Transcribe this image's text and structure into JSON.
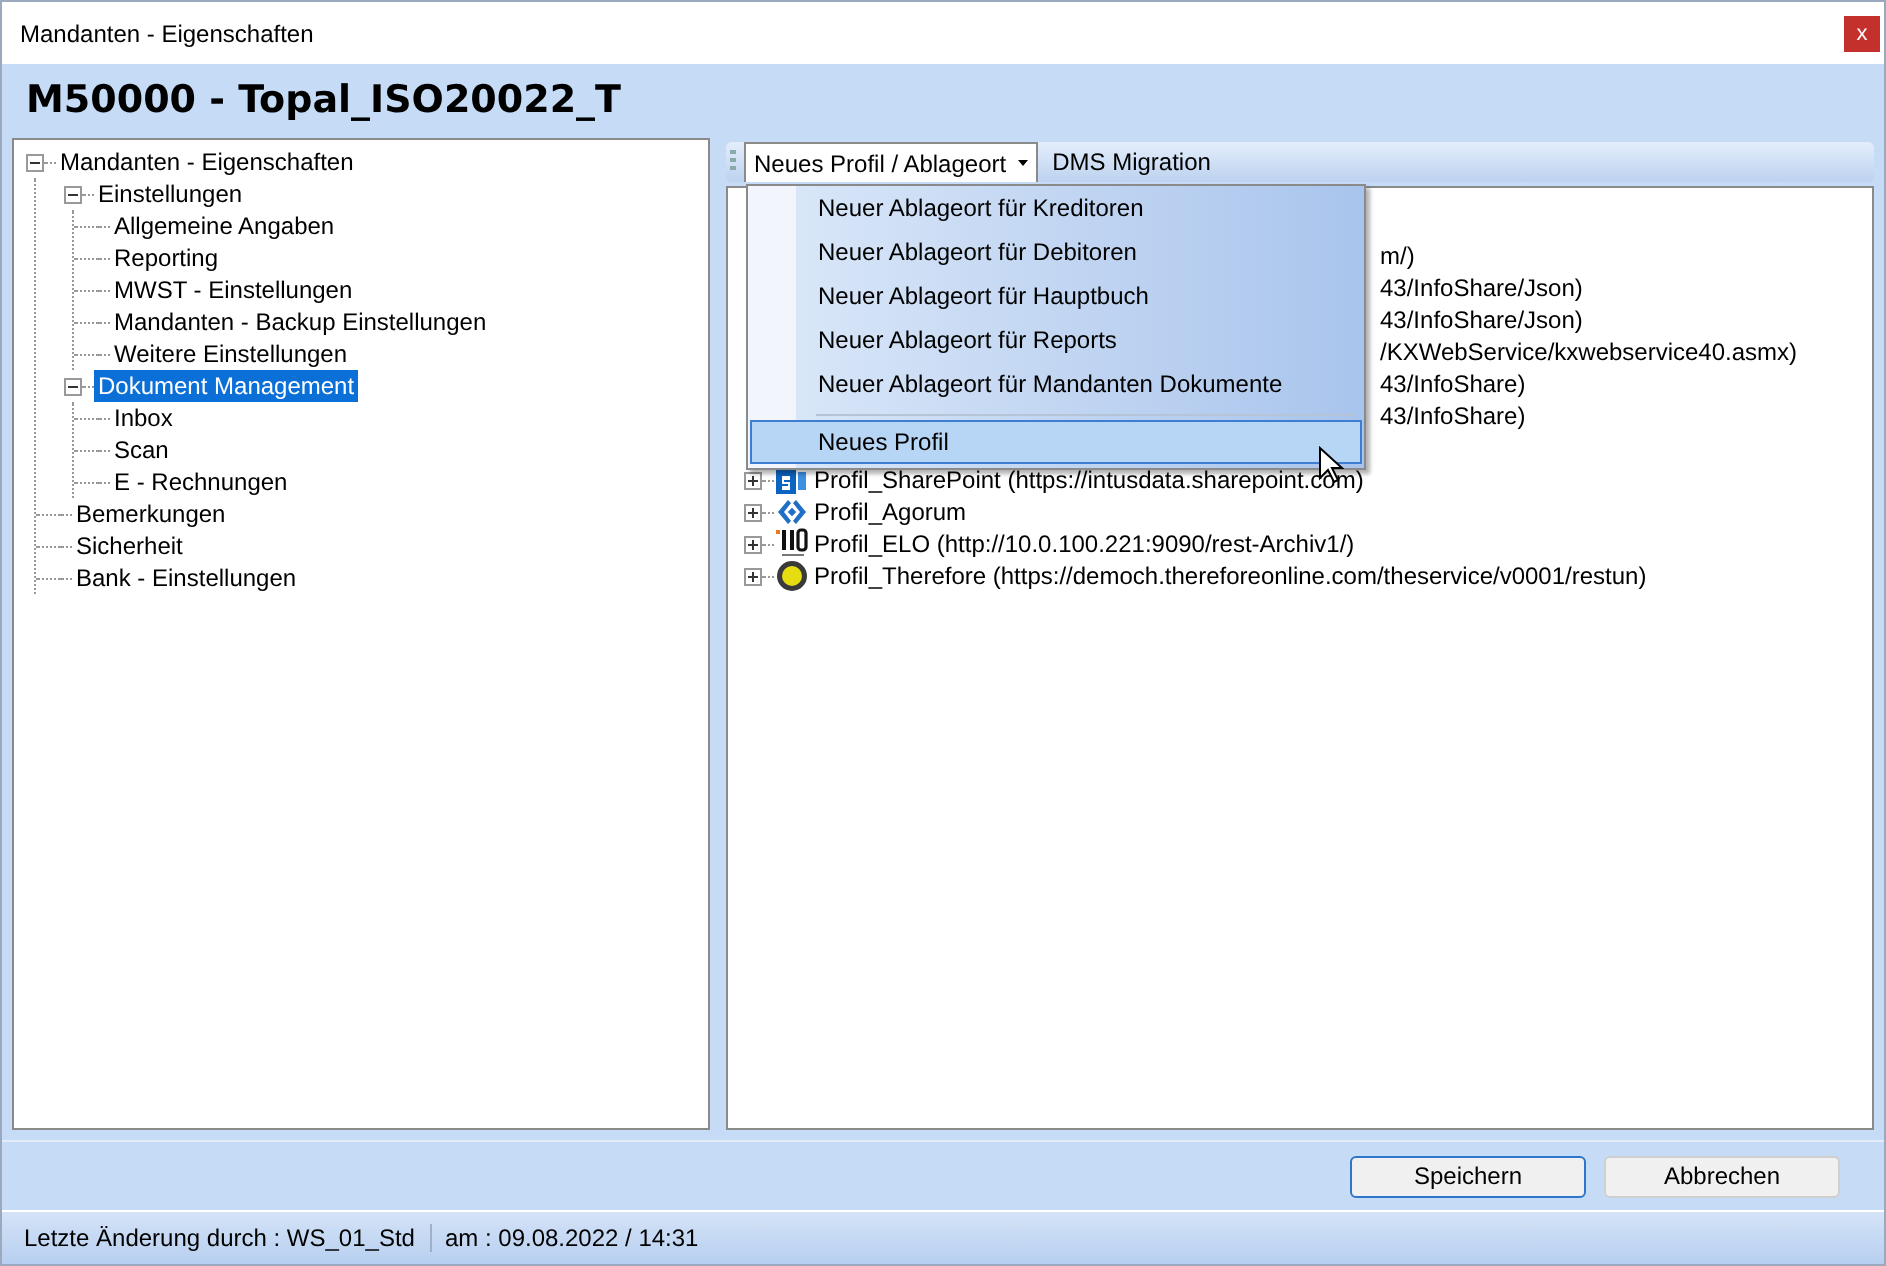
{
  "window": {
    "title": "Mandanten - Eigenschaften",
    "close": "x"
  },
  "header": {
    "title": "M50000 - Topal_ISO20022_T"
  },
  "nav_tree": [
    {
      "label": "Mandanten - Eigenschaften",
      "selected": false,
      "expanded": true,
      "children": [
        {
          "label": "Einstellungen",
          "selected": false,
          "expanded": true,
          "children": [
            {
              "label": "Allgemeine Angaben",
              "selected": false
            },
            {
              "label": "Reporting",
              "selected": false
            },
            {
              "label": "MWST - Einstellungen",
              "selected": false
            },
            {
              "label": "Mandanten - Backup Einstellungen",
              "selected": false
            },
            {
              "label": "Weitere Einstellungen",
              "selected": false
            }
          ]
        },
        {
          "label": "Dokument Management",
          "selected": true,
          "expanded": true,
          "children": [
            {
              "label": "Inbox",
              "selected": false
            },
            {
              "label": "Scan",
              "selected": false
            },
            {
              "label": "E - Rechnungen",
              "selected": false
            }
          ]
        },
        {
          "label": "Bemerkungen",
          "selected": false
        },
        {
          "label": "Sicherheit",
          "selected": false
        },
        {
          "label": "Bank - Einstellungen",
          "selected": false
        }
      ]
    }
  ],
  "toolbar": {
    "items": [
      {
        "label": "Neues Profil / Ablageort",
        "kind": "dropdown",
        "selected": true
      },
      {
        "label": "DMS Migration",
        "kind": "button",
        "selected": false
      }
    ]
  },
  "dropdown_menu": {
    "items": [
      {
        "kind": "item",
        "label": "Neuer Ablageort für Kreditoren",
        "selected": false
      },
      {
        "kind": "item",
        "label": "Neuer Ablageort für Debitoren",
        "selected": false
      },
      {
        "kind": "item",
        "label": "Neuer Ablageort für Hauptbuch",
        "selected": false
      },
      {
        "kind": "item",
        "label": "Neuer Ablageort für Reports",
        "selected": false
      },
      {
        "kind": "item",
        "label": "Neuer Ablageort für Mandanten Dokumente",
        "selected": false
      },
      {
        "kind": "separator"
      },
      {
        "kind": "item",
        "label": "Neues Profil",
        "selected": true
      }
    ]
  },
  "profiles_tree": {
    "rows": [
      {
        "kind": "hidden"
      },
      {
        "kind": "covered",
        "text": "m/)"
      },
      {
        "kind": "covered",
        "text": "43/InfoShare/Json)"
      },
      {
        "kind": "covered",
        "text": "43/InfoShare/Json)"
      },
      {
        "kind": "covered",
        "text": "/KXWebService/kxwebservice40.asmx)"
      },
      {
        "kind": "covered",
        "text": "43/InfoShare)"
      },
      {
        "kind": "covered",
        "text": "43/InfoShare)"
      },
      {
        "kind": "hidden"
      },
      {
        "kind": "profile",
        "expanded": false,
        "text": "Profil_SharePoint (https://intusdata.sharepoint.com)"
      },
      {
        "kind": "profile",
        "expanded": false,
        "text": "Profil_Agorum"
      },
      {
        "kind": "profile",
        "expanded": false,
        "text": "Profil_ELO (http://10.0.100.221:9090/rest-Archiv1/)"
      },
      {
        "kind": "profile",
        "expanded": false,
        "text": "Profil_Therefore (https://democh.thereforeonline.com/theservice/v0001/restun)"
      }
    ]
  },
  "buttons": [
    {
      "label": "Speichern",
      "focused": true
    },
    {
      "label": "Abbrechen",
      "focused": false
    }
  ],
  "status_bar": {
    "last_change": "Letzte Änderung durch : WS_01_Std",
    "date": "am : 09.08.2022 / 14:31"
  }
}
